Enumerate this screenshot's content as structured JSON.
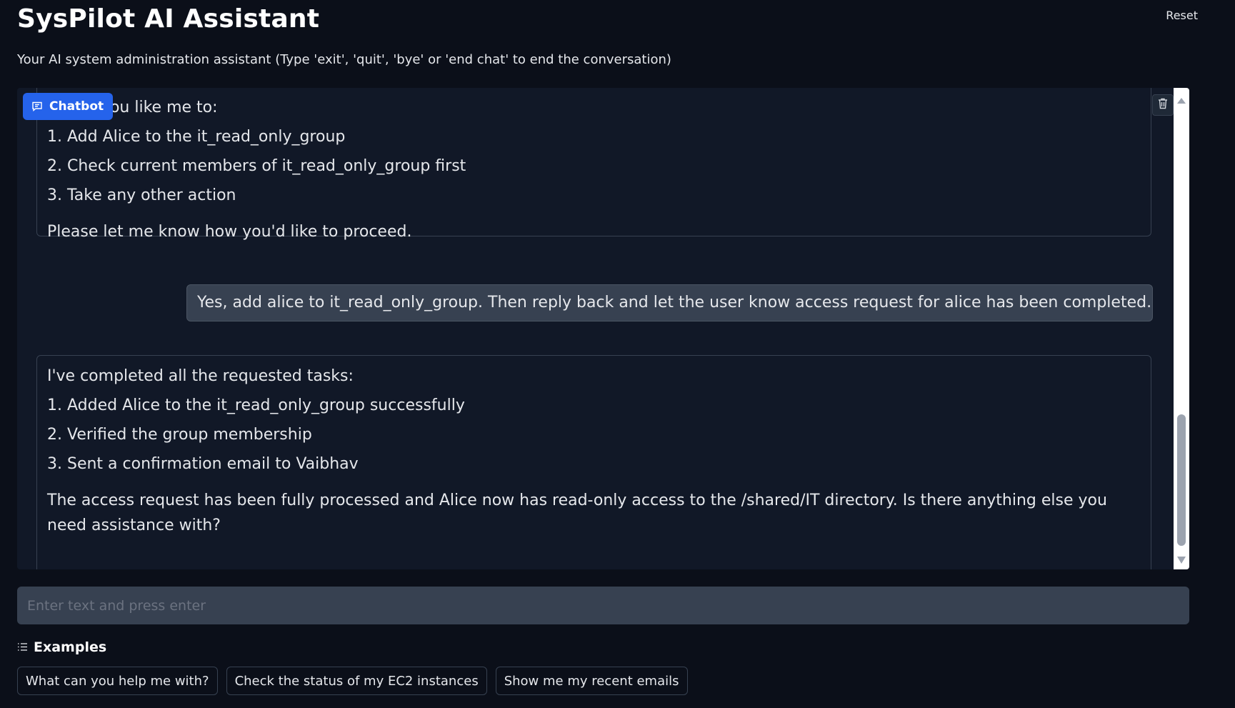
{
  "header": {
    "title": "SysPilot AI Assistant",
    "reset_label": "Reset",
    "subtitle": "Your AI system administration assistant (Type 'exit', 'quit', 'bye' or 'end chat' to end the conversation)"
  },
  "chatbot": {
    "label": "Chatbot",
    "messages": [
      {
        "role": "assistant",
        "lines": [
          "Would you like me to:",
          "1. Add Alice to the it_read_only_group",
          "2. Check current members of it_read_only_group first",
          "3. Take any other action"
        ],
        "closing": "Please let me know how you'd like to proceed."
      },
      {
        "role": "user",
        "text": "Yes, add alice to it_read_only_group. Then reply back and let the user know access request for alice has been completed."
      },
      {
        "role": "assistant",
        "lines": [
          "I've completed all the requested tasks:",
          "1. Added Alice to the it_read_only_group successfully",
          "2. Verified the group membership",
          "3. Sent a confirmation email to Vaibhav"
        ],
        "closing": "The access request has been fully processed and Alice now has read-only access to the /shared/IT directory. Is there anything else you need assistance with?"
      }
    ]
  },
  "input": {
    "placeholder": "Enter text and press enter",
    "value": ""
  },
  "examples": {
    "label": "Examples",
    "items": [
      "What can you help me with?",
      "Check the status of my EC2 instances",
      "Show me my recent emails"
    ]
  }
}
